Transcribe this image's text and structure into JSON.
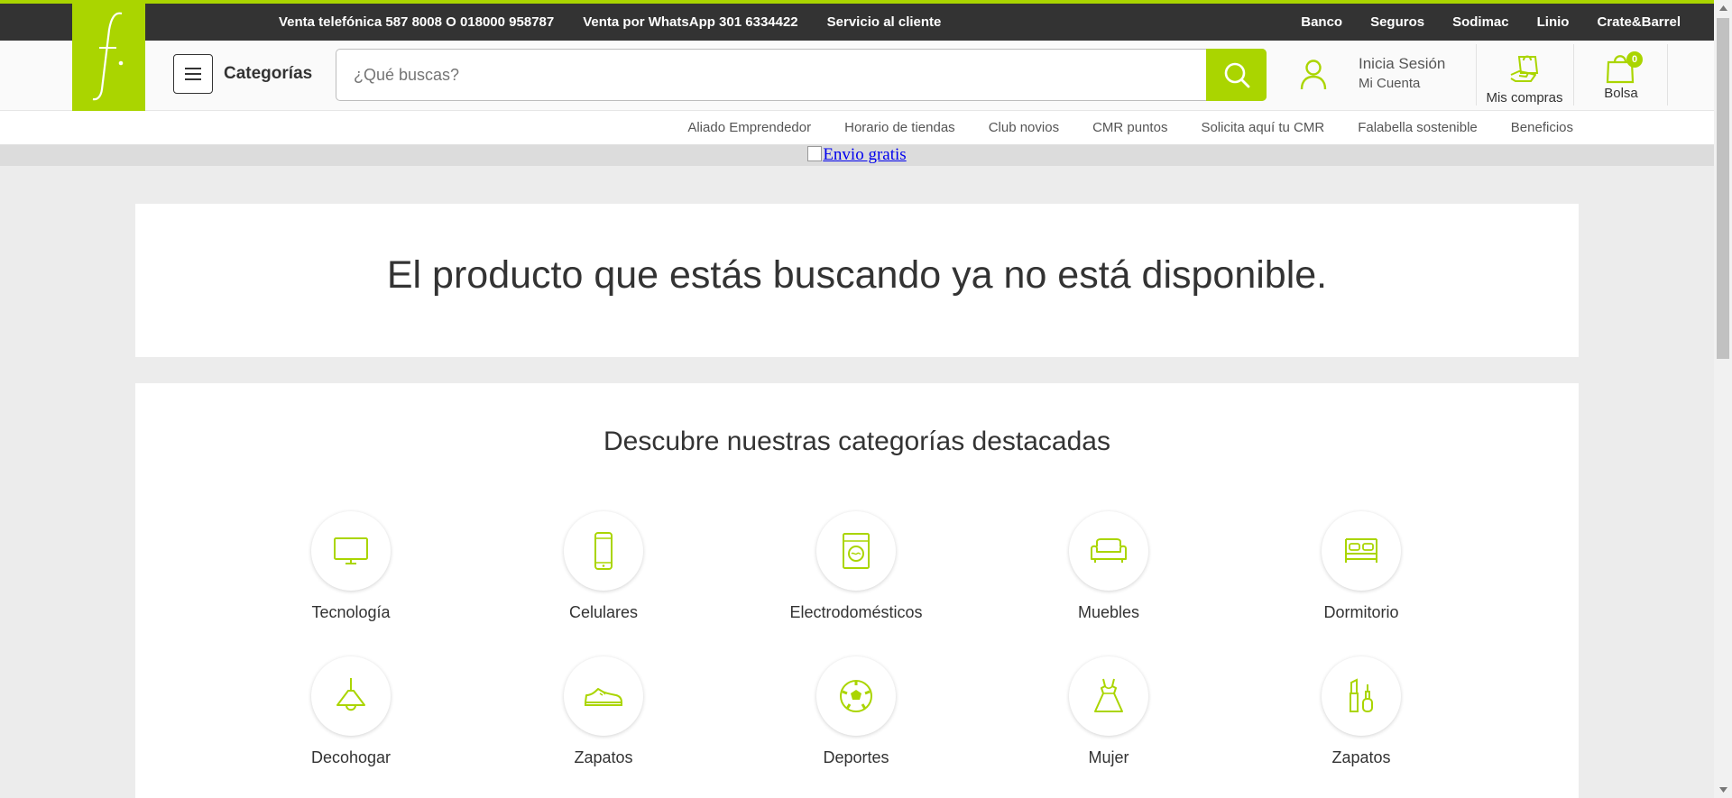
{
  "topbar": {
    "left_links": [
      "Venta telefónica 587 8008 O 018000 958787",
      "Venta por WhatsApp 301 6334422",
      "Servicio al cliente"
    ],
    "right_links": [
      "Banco",
      "Seguros",
      "Sodimac",
      "Linio",
      "Crate&Barrel"
    ]
  },
  "brand": {
    "accent": "#aad500",
    "logo_icon": "falabella-f-logo"
  },
  "header": {
    "categories_label": "Categorías",
    "search_placeholder": "¿Qué buscas?",
    "account_line1": "Inicia Sesión",
    "account_line2": "Mi Cuenta",
    "purchases_label": "Mis compras",
    "cart_label": "Bolsa",
    "cart_count": "0"
  },
  "subnav": {
    "links": [
      "Aliado Emprendedor",
      "Horario de tiendas",
      "Club novios",
      "CMR puntos",
      "Solicita aquí tu CMR",
      "Falabella sostenible",
      "Beneficios"
    ]
  },
  "banner": {
    "alt_text": "Envio gratis"
  },
  "main": {
    "unavailable_message": "El producto que estás buscando ya no está disponible.",
    "categories_title": "Descubre nuestras categorías destacadas",
    "categories": [
      {
        "label": "Tecnología",
        "icon": "tv-icon"
      },
      {
        "label": "Celulares",
        "icon": "phone-icon"
      },
      {
        "label": "Electrodomésticos",
        "icon": "washer-icon"
      },
      {
        "label": "Muebles",
        "icon": "sofa-icon"
      },
      {
        "label": "Dormitorio",
        "icon": "bed-icon"
      },
      {
        "label": "Decohogar",
        "icon": "lamp-icon"
      },
      {
        "label": "Zapatos",
        "icon": "sneaker-icon"
      },
      {
        "label": "Deportes",
        "icon": "soccer-ball-icon"
      },
      {
        "label": "Mujer",
        "icon": "dress-icon"
      },
      {
        "label": "Zapatos",
        "icon": "makeup-icon"
      }
    ]
  }
}
